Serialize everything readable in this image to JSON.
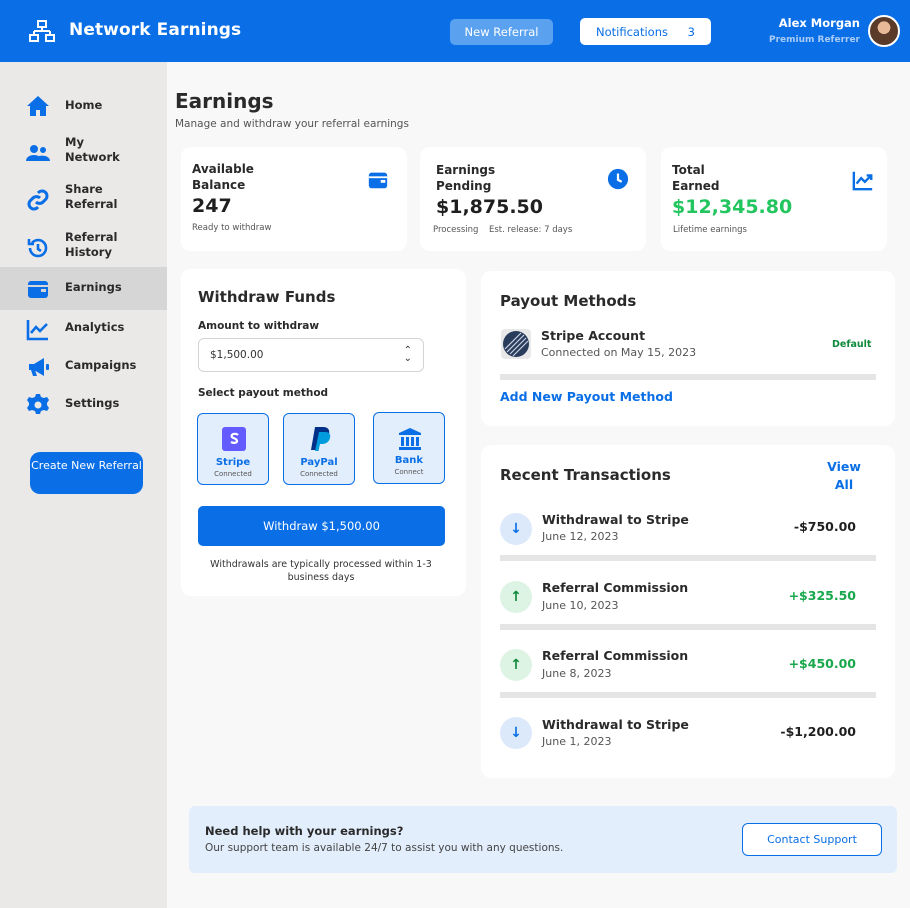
{
  "header": {
    "brand_icon": "network-icon",
    "title": "Network Earnings",
    "new_referral_label": "New Referral",
    "notifications_label": "Notifications",
    "notifications_count": "3",
    "user_name": "Alex Morgan",
    "user_role": "Premium Referrer",
    "accent": "#0a6fe6"
  },
  "sidebar": {
    "items": [
      {
        "label": "Home",
        "icon": "home-icon"
      },
      {
        "label": "My Network",
        "icon": "users-icon"
      },
      {
        "label": "Share Referral",
        "icon": "link-icon"
      },
      {
        "label": "Referral History",
        "icon": "history-icon"
      },
      {
        "label": "Earnings",
        "icon": "wallet-icon",
        "active": true
      },
      {
        "label": "Analytics",
        "icon": "chart-line-icon"
      },
      {
        "label": "Campaigns",
        "icon": "megaphone-icon"
      },
      {
        "label": "Settings",
        "icon": "gear-icon"
      }
    ],
    "create_label": "Create New Referral"
  },
  "page": {
    "title": "Earnings",
    "subtitle": "Manage and withdraw your referral earnings"
  },
  "stats": [
    {
      "label": "Available Balance",
      "value": "247",
      "note": "Ready to withdraw",
      "icon": "wallet-icon"
    },
    {
      "label": "Earnings Pending",
      "value": "$1,875.50",
      "note": "Processing",
      "note2": "Est. release: 7 days",
      "icon": "clock-icon"
    },
    {
      "label": "Total Earned",
      "value": "$12,345.80",
      "note": "Lifetime earnings",
      "icon": "chart-up-icon",
      "value_color": "#22c55e"
    }
  ],
  "withdraw": {
    "title": "Withdraw Funds",
    "amount_label": "Amount to withdraw",
    "amount_value": "$1,500.00",
    "method_label": "Select payout method",
    "methods": [
      {
        "name": "Stripe",
        "status": "Connected",
        "icon": "stripe-icon"
      },
      {
        "name": "PayPal",
        "status": "Connected",
        "icon": "paypal-icon"
      },
      {
        "name": "Bank",
        "status": "Connect",
        "icon": "bank-icon"
      }
    ],
    "button_label": "Withdraw $1,500.00",
    "note": "Withdrawals are typically processed within 1-3 business days"
  },
  "payout": {
    "title": "Payout Methods",
    "account_name": "Stripe Account",
    "account_sub": "Connected on May 15, 2023",
    "default_label": "Default",
    "add_label": "Add New Payout Method"
  },
  "transactions": {
    "title": "Recent Transactions",
    "view_all": "View All",
    "items": [
      {
        "title": "Withdrawal to Stripe",
        "date": "June 12, 2023",
        "amount": "-$750.00",
        "direction": "down"
      },
      {
        "title": "Referral Commission",
        "date": "June 10, 2023",
        "amount": "+$325.50",
        "direction": "up"
      },
      {
        "title": "Referral Commission",
        "date": "June 8, 2023",
        "amount": "+$450.00",
        "direction": "up"
      },
      {
        "title": "Withdrawal to Stripe",
        "date": "June 1, 2023",
        "amount": "-$1,200.00",
        "direction": "down"
      }
    ]
  },
  "help": {
    "title": "Need help with your earnings?",
    "subtitle": "Our support team is available 24/7 to assist you with any questions.",
    "contact_label": "Contact Support"
  }
}
